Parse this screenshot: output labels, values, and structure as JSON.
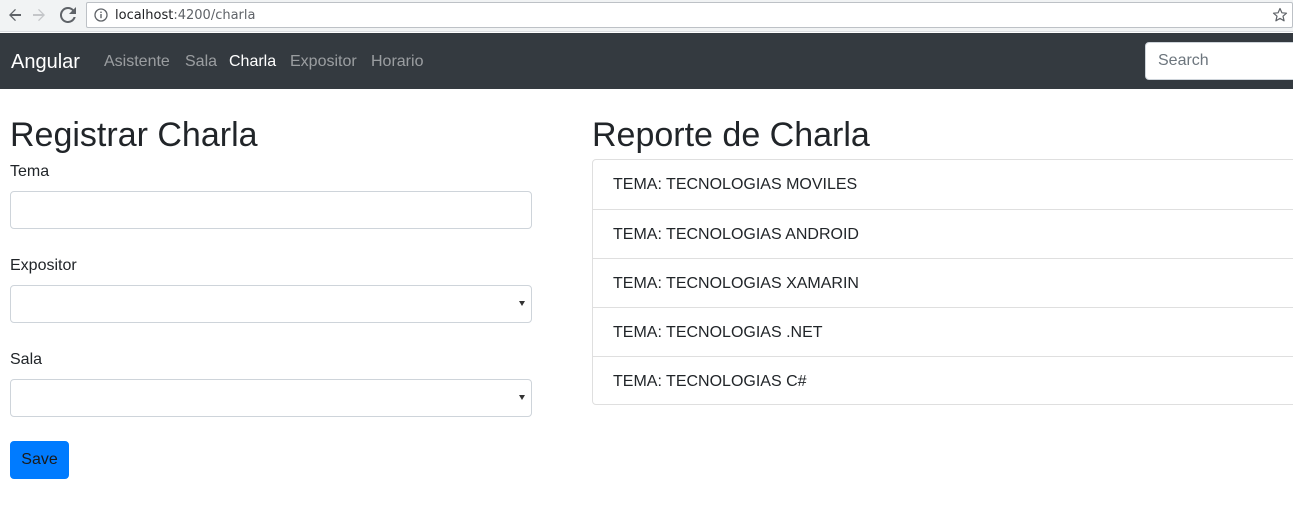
{
  "browser": {
    "url_host": "localhost",
    "url_rest": ":4200/charla"
  },
  "navbar": {
    "brand": "Angular",
    "links": [
      {
        "label": "Asistente",
        "active": false
      },
      {
        "label": "Sala",
        "active": false
      },
      {
        "label": "Charla",
        "active": true
      },
      {
        "label": "Expositor",
        "active": false
      },
      {
        "label": "Horario",
        "active": false
      }
    ],
    "search_placeholder": "Search"
  },
  "form": {
    "title": "Registrar Charla",
    "tema_label": "Tema",
    "tema_value": "",
    "expositor_label": "Expositor",
    "expositor_value": "",
    "sala_label": "Sala",
    "sala_value": "",
    "save_label": "Save"
  },
  "report": {
    "title": "Reporte de Charla",
    "items": [
      "TEMA: TECNOLOGIAS MOVILES",
      "TEMA: TECNOLOGIAS ANDROID",
      "TEMA: TECNOLOGIAS XAMARIN",
      "TEMA: TECNOLOGIAS .NET",
      "TEMA: TECNOLOGIAS C#"
    ]
  },
  "colors": {
    "navbar_bg": "#343a40",
    "primary": "#007bff"
  }
}
